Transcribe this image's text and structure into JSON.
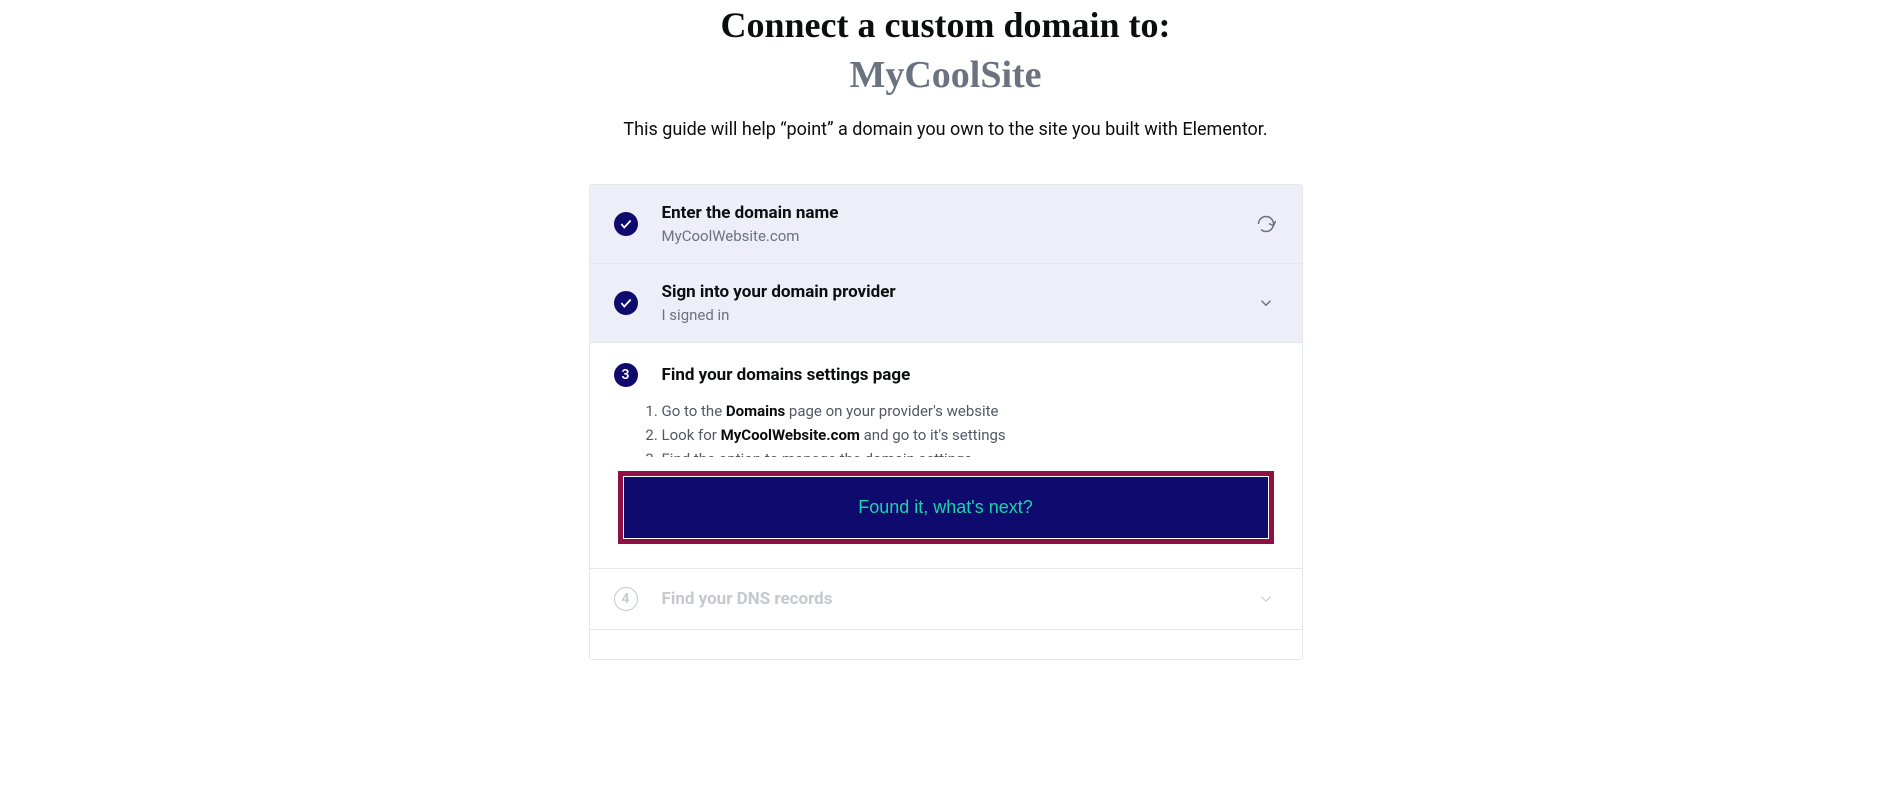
{
  "header": {
    "title_line1": "Connect a custom domain to:",
    "title_line2": "MyCoolSite",
    "subtitle": "This guide will help “point” a domain you own to the site you built with Elementor."
  },
  "steps": {
    "enter_domain": {
      "title": "Enter the domain name",
      "value": "MyCoolWebsite.com"
    },
    "sign_in": {
      "title": "Sign into your domain provider",
      "status": "I signed in"
    },
    "find_settings": {
      "number": "3",
      "title": "Find your domains settings page",
      "instr1_pre": "Go to the ",
      "instr1_b": "Domains",
      "instr1_post": " page on your provider's website",
      "instr2_pre": "Look for ",
      "instr2_b": "MyCoolWebsite.com",
      "instr2_post": " and go to it's settings",
      "instr3": "Find the option to manage the domain settings",
      "cta": "Found it, what's next?"
    },
    "find_dns": {
      "number": "4",
      "title": "Find your DNS records"
    }
  }
}
